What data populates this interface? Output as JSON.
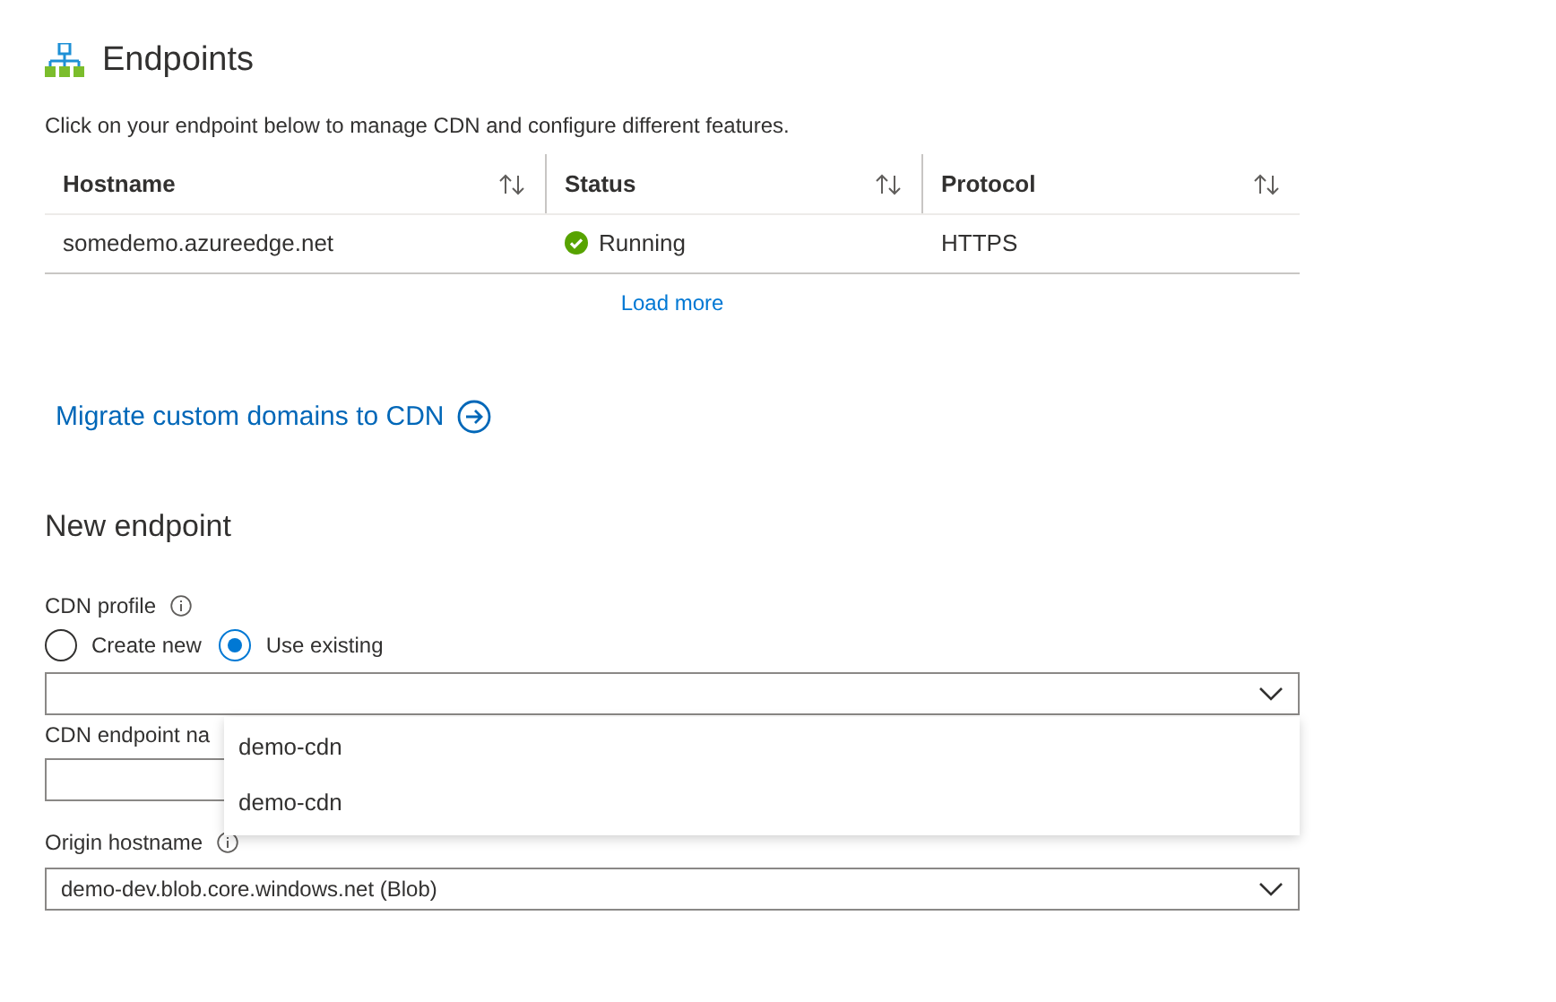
{
  "header": {
    "title": "Endpoints"
  },
  "description": "Click on your endpoint below to manage CDN and configure different features.",
  "table": {
    "columns": [
      {
        "label": "Hostname"
      },
      {
        "label": "Status"
      },
      {
        "label": "Protocol"
      }
    ],
    "rows": [
      {
        "hostname": "somedemo.azureedge.net",
        "kind": "running",
        "status": "Running",
        "protocol": "HTTPS"
      }
    ],
    "load_more": "Load more"
  },
  "migrate_link": "Migrate custom domains to CDN",
  "new_endpoint": {
    "title": "New endpoint",
    "cdn_profile": {
      "label": "CDN profile",
      "options": [
        {
          "label": "Create new",
          "selected": false
        },
        {
          "label": "Use existing",
          "selected": true
        }
      ],
      "menu_open": true,
      "menu_items": [
        "demo-cdn",
        "demo-cdn"
      ]
    },
    "endpoint_name": {
      "label": "CDN endpoint na"
    },
    "origin_hostname": {
      "label": "Origin hostname",
      "value": "demo-dev.blob.core.windows.net (Blob)"
    }
  }
}
